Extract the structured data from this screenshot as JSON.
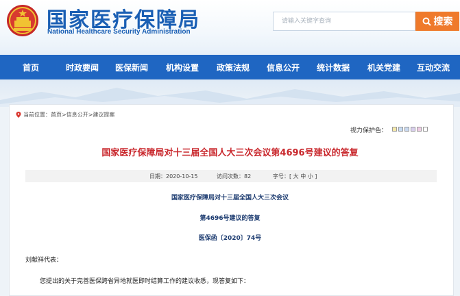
{
  "header": {
    "title_cn": "国家医疗保障局",
    "title_en": "National Healthcare Security Administration",
    "search_placeholder": "请输入关键字查询",
    "search_button": "搜索"
  },
  "nav": {
    "items": [
      "首页",
      "时政要闻",
      "医保新闻",
      "机构设置",
      "政策法规",
      "信息公开",
      "统计数据",
      "机关党建",
      "互动交流"
    ]
  },
  "breadcrumb": "当前位置：首页>信息公开>建议提案",
  "vision_label": "视力保护色：",
  "vision_colors": [
    "#f5e9a8",
    "#c7dcf4",
    "#c9d9f0",
    "#d9cfee",
    "#f0cde6",
    "#ffffff"
  ],
  "article": {
    "title": "国家医疗保障局对十三届全国人大三次会议第4696号建议的答复",
    "date": "日期：2020-10-15",
    "visits": "访问次数：82",
    "font_size": "字号：[ 大 中 小 ]",
    "heading_line1": "国家医疗保障局对十三届全国人大三次会议",
    "heading_line2": "第4696号建议的答复",
    "doc_number": "医保函〔2020〕74号",
    "salutation": "刘献祥代表：",
    "body_first": "您提出的关于完善医保跨省异地就医即时结算工作的建议收悉，现答复如下："
  },
  "colors": {
    "brand_blue": "#1a5fb4",
    "nav_blue": "#1f66c2",
    "search_orange": "#ef7a2b",
    "title_red": "#c9282d"
  }
}
